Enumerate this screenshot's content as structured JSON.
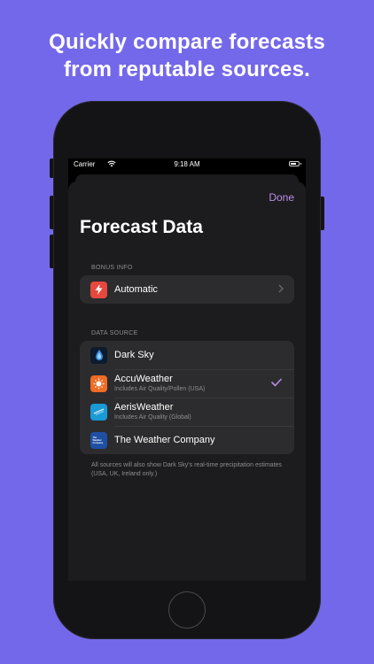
{
  "headline": {
    "line1": "Quickly compare forecasts",
    "line2": "from reputable sources."
  },
  "status_bar": {
    "carrier": "Carrier",
    "time": "9:18 AM"
  },
  "sheet": {
    "done_label": "Done",
    "title": "Forecast Data"
  },
  "bonus_info": {
    "header": "BONUS INFO",
    "row": {
      "label": "Automatic",
      "icon": "lightning-icon"
    }
  },
  "data_source": {
    "header": "DATA SOURCE",
    "selected": "AccuWeather",
    "items": [
      {
        "label": "Dark Sky",
        "subtitle": "",
        "icon": "dark-sky-icon"
      },
      {
        "label": "AccuWeather",
        "subtitle": "Includes Air Quality/Pollen (USA)",
        "icon": "accuweather-icon"
      },
      {
        "label": "AerisWeather",
        "subtitle": "Includes Air Quality (Global)",
        "icon": "aerisweather-icon"
      },
      {
        "label": "The Weather Company",
        "subtitle": "",
        "icon": "weather-company-icon",
        "logo_text": "The Weather Company"
      }
    ],
    "footnote": "All sources will also show Dark Sky's real-time precipitation estimates (USA, UK, Ireland only.)"
  },
  "colors": {
    "background": "#7468ea",
    "accent": "#b98ee7",
    "lightning": "#e7483e",
    "accuweather": "#f06b23",
    "aeris": "#1a9ad6",
    "weather_company": "#1f4fa3"
  }
}
